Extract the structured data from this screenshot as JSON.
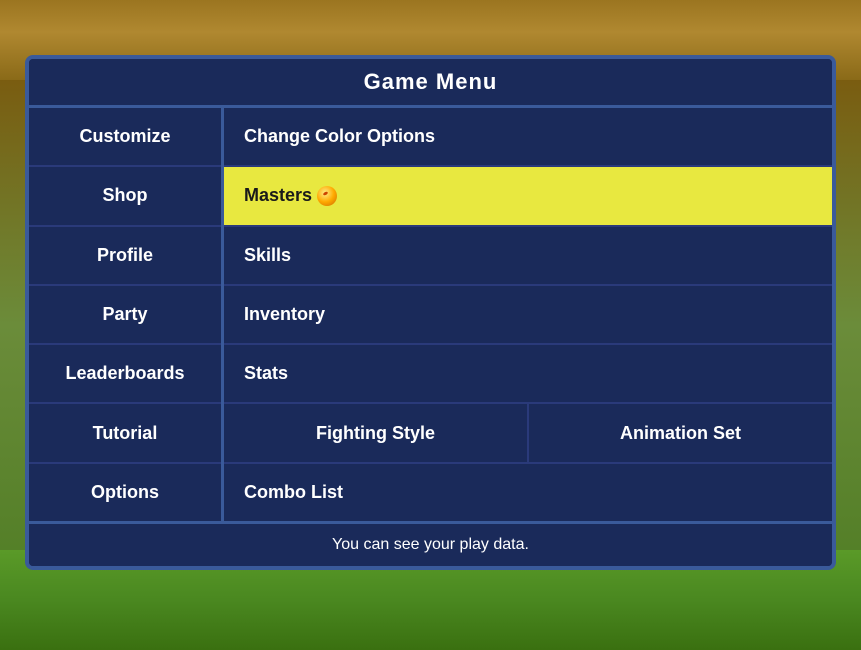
{
  "background": {
    "alt": "Game background with dirt and grass"
  },
  "menu": {
    "title": "Game Menu",
    "nav_items": [
      {
        "id": "customize",
        "label": "Customize"
      },
      {
        "id": "shop",
        "label": "Shop"
      },
      {
        "id": "profile",
        "label": "Profile"
      },
      {
        "id": "party",
        "label": "Party"
      },
      {
        "id": "leaderboards",
        "label": "Leaderboards"
      },
      {
        "id": "tutorial",
        "label": "Tutorial"
      },
      {
        "id": "options",
        "label": "Options"
      }
    ],
    "content_items": [
      {
        "id": "change-color-options",
        "label": "Change Color Options",
        "highlighted": false,
        "type": "single"
      },
      {
        "id": "masters",
        "label": "Masters",
        "highlighted": true,
        "type": "single"
      },
      {
        "id": "skills",
        "label": "Skills",
        "highlighted": false,
        "type": "single"
      },
      {
        "id": "inventory",
        "label": "Inventory",
        "highlighted": false,
        "type": "single"
      },
      {
        "id": "stats",
        "label": "Stats",
        "highlighted": false,
        "type": "single"
      },
      {
        "id": "fighting-animation",
        "label": "",
        "highlighted": false,
        "type": "double",
        "left": "Fighting Style",
        "right": "Animation Set"
      },
      {
        "id": "combo-list",
        "label": "Combo List",
        "highlighted": false,
        "type": "single"
      }
    ],
    "footer_text": "You can see your play data."
  }
}
